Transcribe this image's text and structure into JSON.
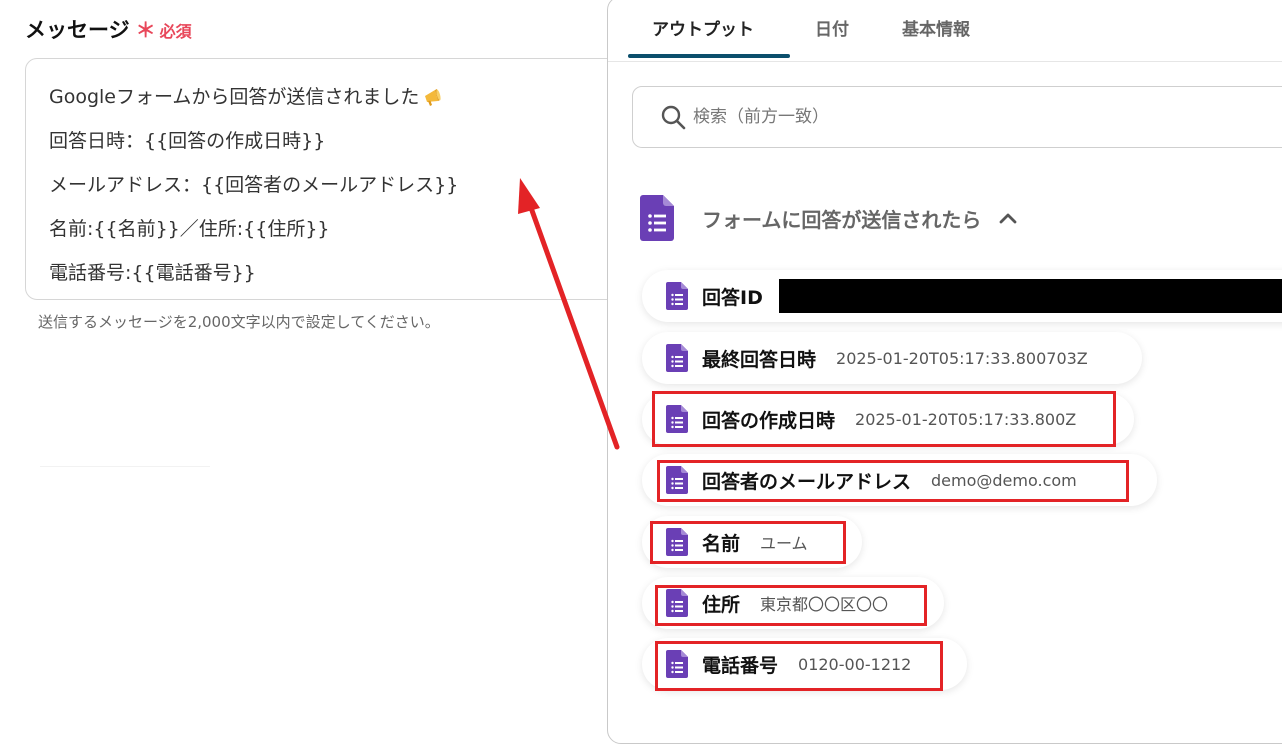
{
  "message": {
    "label": "メッセージ",
    "required_star": "＊",
    "required_text": "必須",
    "lines": [
      "Googleフォームから回答が送信されました",
      "回答日時：{{回答の作成日時}}",
      "メールアドレス：{{回答者のメールアドレス}}",
      "名前:{{名前}}／住所:{{住所}}",
      "電話番号:{{電話番号}}"
    ],
    "hint": "送信するメッセージを2,000文字以内で設定してください。"
  },
  "panel": {
    "tabs": [
      {
        "label": "アウトプット",
        "active": true
      },
      {
        "label": "日付",
        "active": false
      },
      {
        "label": "基本情報",
        "active": false
      }
    ],
    "search": {
      "placeholder": "検索（前方一致）"
    },
    "section_title": "フォームに回答が送信されたら",
    "items": [
      {
        "label": "回答ID",
        "value": ""
      },
      {
        "label": "最終回答日時",
        "value": "2025-01-20T05:17:33.800703Z"
      },
      {
        "label": "回答の作成日時",
        "value": "2025-01-20T05:17:33.800Z"
      },
      {
        "label": "回答者のメールアドレス",
        "value": "demo@demo.com"
      },
      {
        "label": "名前",
        "value": "ユーム"
      },
      {
        "label": "住所",
        "value": "東京都〇〇区〇〇"
      },
      {
        "label": "電話番号",
        "value": "0120-00-1212"
      }
    ]
  },
  "colors": {
    "accent_tab": "#0b4f6c",
    "required": "#e8475a",
    "annotation_red": "#e32326",
    "forms_purple": "#6a3fb5"
  }
}
